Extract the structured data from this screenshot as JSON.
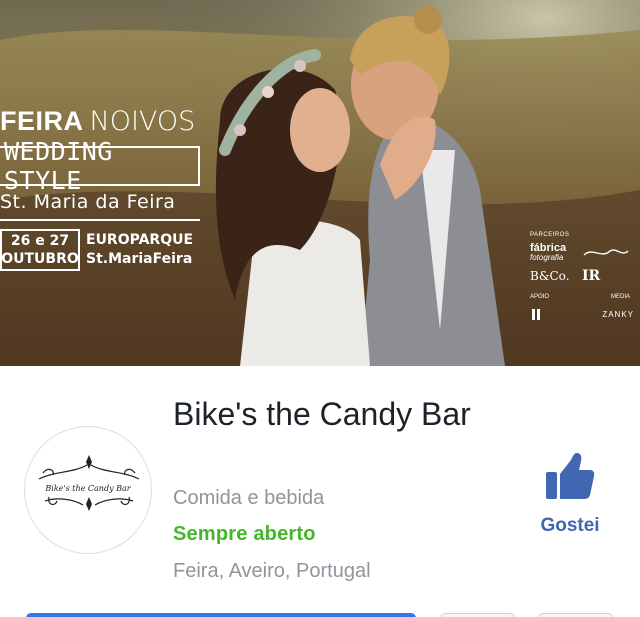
{
  "cover": {
    "event_word1": "FEIRA",
    "event_word2": "NOIVOS",
    "style_line": "WEDDING STYLE",
    "city_line": "St. Maria da Feira",
    "date_days": "26 e 27",
    "date_month": "OUTUBRO",
    "venue_name": "EUROPARQUE",
    "venue_city": "St.MariaFeira",
    "partners": {
      "heading": "PARCEIROS",
      "fabrica_main": "fábrica",
      "fabrica_sub": "fotografia",
      "bco": "B&Co.",
      "ir": "IR",
      "apoio": "APOIO",
      "media": "MEDIA",
      "zank": "ZANKY"
    }
  },
  "page": {
    "avatar_text": "Bike's the Candy Bar",
    "name": "Bike's the Candy Bar",
    "category": "Comida e bebida",
    "hours": "Sempre aberto",
    "location": "Feira, Aveiro, Portugal"
  },
  "like": {
    "icon": "thumbs-up-icon",
    "label": "Gostei",
    "color": "#4267b2"
  },
  "colors": {
    "open_status": "#42b72a",
    "secondary_text": "#90949c",
    "primary_button": "#3578e5"
  }
}
